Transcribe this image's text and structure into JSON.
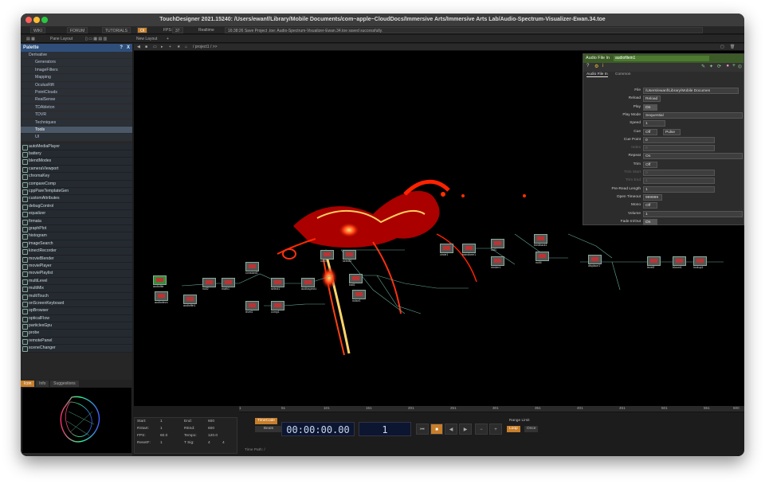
{
  "window": {
    "title": "TouchDesigner 2021.15240: /Users/ewanf/Library/Mobile Documents/com~apple~CloudDocs/Immersive Arts/Immersive Arts Lab/Audio-Spectrum-Visualizer-Ewan.34.toe"
  },
  "menubar": {
    "wiki": "WIKI",
    "forum": "FORUM",
    "tutorials": "TUTORIALS",
    "oi": "OI",
    "fps_label": "FPS:",
    "fps_value": "37",
    "realtime": "Realtime",
    "status": "16:38:26 Save Project .toe: Audio-Spectrum-Visualizer-Ewan.34.toe saved successfully."
  },
  "toolbar2": {
    "pane_layout": "Pane Layout",
    "new_layout": "New Layout"
  },
  "palette": {
    "title": "Palette",
    "tree": [
      "Derivative",
      "Generators",
      "ImageFilters",
      "Mapping",
      "OculusRift",
      "PointClouds",
      "RealSense",
      "TDAbleton",
      "TDVR",
      "Techniques",
      "Tools",
      "UI"
    ],
    "components": [
      "autoMediaPlayer",
      "battery",
      "blendModes",
      "cameraViewport",
      "chromaKey",
      "compareComp",
      "cppPareTemplateGen",
      "customAttributes",
      "debugControl",
      "equalizer",
      "firmata",
      "graphPlot",
      "histogram",
      "imageSearch",
      "kinectRecorder",
      "movieBlender",
      "moviePlayer",
      "moviePlaylist",
      "multiLevel",
      "multiMix",
      "multiTouch",
      "onScreenKeyboard",
      "opBrowser",
      "opticalFlow",
      "particlesGpu",
      "probe",
      "remotePanel",
      "sceneChanger"
    ],
    "tabs": [
      "Icon",
      "Info",
      "Suggestions"
    ]
  },
  "network": {
    "path": "/ project1 / >>"
  },
  "params": {
    "op_type": "Audio File In",
    "op_name": "audiofilein1",
    "tabs": [
      "Audio File In",
      "Common"
    ],
    "rows": [
      {
        "label": "File",
        "value": "/Users/ewanf/Library/Mobile Documen"
      },
      {
        "label": "Reload",
        "value": "Reload"
      },
      {
        "label": "Play",
        "value": "On"
      },
      {
        "label": "Play Mode",
        "value": "Sequential"
      },
      {
        "label": "Speed",
        "value": "1"
      },
      {
        "label": "Cue",
        "value": "Off"
      },
      {
        "label": "Cue Point",
        "value": "0"
      },
      {
        "label": "Index",
        "value": "0"
      },
      {
        "label": "Repeat",
        "value": "On"
      },
      {
        "label": "Trim",
        "value": "Off"
      },
      {
        "label": "Trim Start",
        "value": "0"
      },
      {
        "label": "Trim End",
        "value": "1"
      },
      {
        "label": "Pre-Read Length",
        "value": "1"
      },
      {
        "label": "Open Timeout",
        "value": "999999"
      },
      {
        "label": "Mono",
        "value": "Off"
      },
      {
        "label": "Volume",
        "value": "1"
      },
      {
        "label": "Fade In/Out",
        "value": "On"
      }
    ],
    "pulse": "Pulse"
  },
  "timeline": {
    "ticks": [
      "1",
      "51",
      "101",
      "151",
      "201",
      "251",
      "301",
      "351",
      "401",
      "451",
      "501",
      "551",
      "600"
    ],
    "start": "1",
    "end": "600",
    "rstart": "1",
    "rend": "600",
    "fps": "60.0",
    "tempo": "120.0",
    "resetf": "1",
    "tsig1": "4",
    "tsig2": "4",
    "timecode_btn": "TimeCode",
    "beats_btn": "Beats",
    "timecode": "00:00:00.00",
    "frame": "1",
    "range_limit": "Range Limit",
    "loop": "Loop",
    "once": "Once",
    "time_path": "Time Path: /"
  },
  "nodes": [
    {
      "n": "audiofile",
      "c": "#3a8a3a"
    },
    {
      "n": "audiodevo",
      "c": "#555"
    },
    {
      "n": "audiofiln1",
      "c": "#555"
    },
    {
      "n": "null2",
      "c": "#555"
    },
    {
      "n": "math1",
      "c": "#555"
    },
    {
      "n": "constant1",
      "c": "#555"
    },
    {
      "n": "select1",
      "c": "#555"
    },
    {
      "n": "audiospect1",
      "c": "#555"
    },
    {
      "n": "null3",
      "c": "#555"
    },
    {
      "n": "select2",
      "c": "#555"
    },
    {
      "n": "trail1",
      "c": "#555"
    },
    {
      "n": "noise1",
      "c": "#555"
    },
    {
      "n": "level1",
      "c": "#555"
    },
    {
      "n": "comp1",
      "c": "#555"
    },
    {
      "n": "circle1",
      "c": "#555"
    },
    {
      "n": "transform1",
      "c": "#555"
    },
    {
      "n": "out1",
      "c": "#555"
    },
    {
      "n": "render1",
      "c": "#555"
    },
    {
      "n": "feedback1",
      "c": "#555"
    },
    {
      "n": "null4",
      "c": "#555"
    },
    {
      "n": "displace1",
      "c": "#555"
    },
    {
      "n": "level2",
      "c": "#555"
    },
    {
      "n": "bloom1",
      "c": "#555"
    },
    {
      "n": "lookup1",
      "c": "#555"
    }
  ]
}
